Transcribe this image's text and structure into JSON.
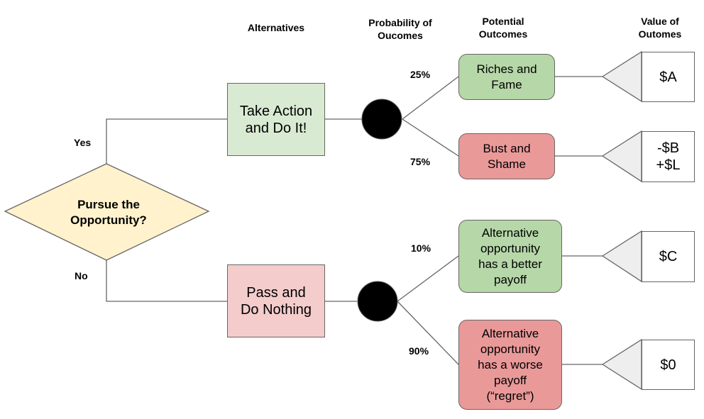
{
  "headers": {
    "alternatives": "Alternatives",
    "probability": "Probability of\nOucomes",
    "outcomes": "Potential\nOutcomes",
    "values": "Value of\nOutomes"
  },
  "decision": {
    "label": "Pursue the\nOpportunity?",
    "yes": "Yes",
    "no": "No"
  },
  "alternatives": [
    {
      "label": "Take Action\nand Do It!"
    },
    {
      "label": "Pass and\nDo Nothing"
    }
  ],
  "outcomes": [
    {
      "probability": "25%",
      "label": "Riches and\nFame",
      "value": "$A"
    },
    {
      "probability": "75%",
      "label": "Bust and\nShame",
      "value": "-$B\n+$L"
    },
    {
      "probability": "10%",
      "label": "Alternative\nopportunity\nhas a better\npayoff",
      "value": "$C"
    },
    {
      "probability": "90%",
      "label": "Alternative\nopportunity\nhas a worse\npayoff\n(“regret”)",
      "value": "$0"
    }
  ],
  "colors": {
    "decision_fill": "#fff2cc",
    "action_fill": "#d9ead3",
    "pass_fill": "#f4cccc",
    "good_outcome": "#b6d7a8",
    "bad_outcome": "#ea9999",
    "terminal_fill": "#eeeeee",
    "line": "#666666"
  }
}
